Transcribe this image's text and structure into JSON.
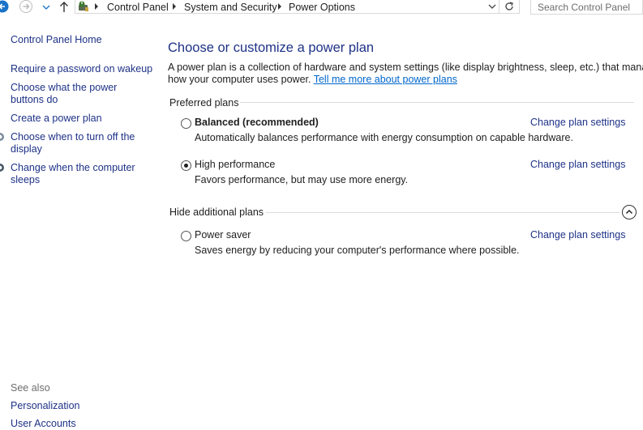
{
  "address_bar": {
    "breadcrumbs": [
      "Control Panel",
      "System and Security",
      "Power Options"
    ],
    "search_placeholder": "Search Control Panel"
  },
  "sidebar": {
    "home": "Control Panel Home",
    "tasks": [
      "Require a password on wakeup",
      "Choose what the power buttons do",
      "Create a power plan",
      "Choose when to turn off the display",
      "Change when the computer sleeps"
    ],
    "task_lines": [
      [
        "Require a password on wakeup"
      ],
      [
        "Choose what the power",
        "buttons do"
      ],
      [
        "Create a power plan"
      ],
      [
        "Choose when to turn off the",
        "display"
      ],
      [
        "Change when the computer",
        "sleeps"
      ]
    ],
    "see_also": "See also",
    "see_also_links": [
      "Personalization",
      "User Accounts"
    ]
  },
  "main": {
    "title": "Choose or customize a power plan",
    "description_line1": "A power plan is a collection of hardware and system settings (like display brightness, sleep, etc.) that manages",
    "description_line2": "how your computer uses power.",
    "more_link": "Tell me more about power plans",
    "preferred_header": "Preferred plans",
    "additional_header": "Hide additional plans",
    "change_label": "Change plan settings",
    "plans": [
      {
        "name": "Balanced (recommended)",
        "description": "Automatically balances performance with energy consumption on capable hardware.",
        "selected": false
      },
      {
        "name": "High performance",
        "description": "Favors performance, but may use more energy.",
        "selected": true
      },
      {
        "name": "Power saver",
        "description": "Saves energy by reducing your computer's performance where possible.",
        "selected": false
      }
    ]
  },
  "colors": {
    "link": "#1e3287",
    "hyperlink": "#0066cc",
    "back_button": "#1a73c8"
  },
  "icons": [
    "back-arrow-icon",
    "forward-arrow-icon",
    "recent-dropdown-icon",
    "up-arrow-icon",
    "power-options-icon",
    "address-dropdown-icon",
    "refresh-icon",
    "shield-icon",
    "collapse-chevron-icon"
  ]
}
